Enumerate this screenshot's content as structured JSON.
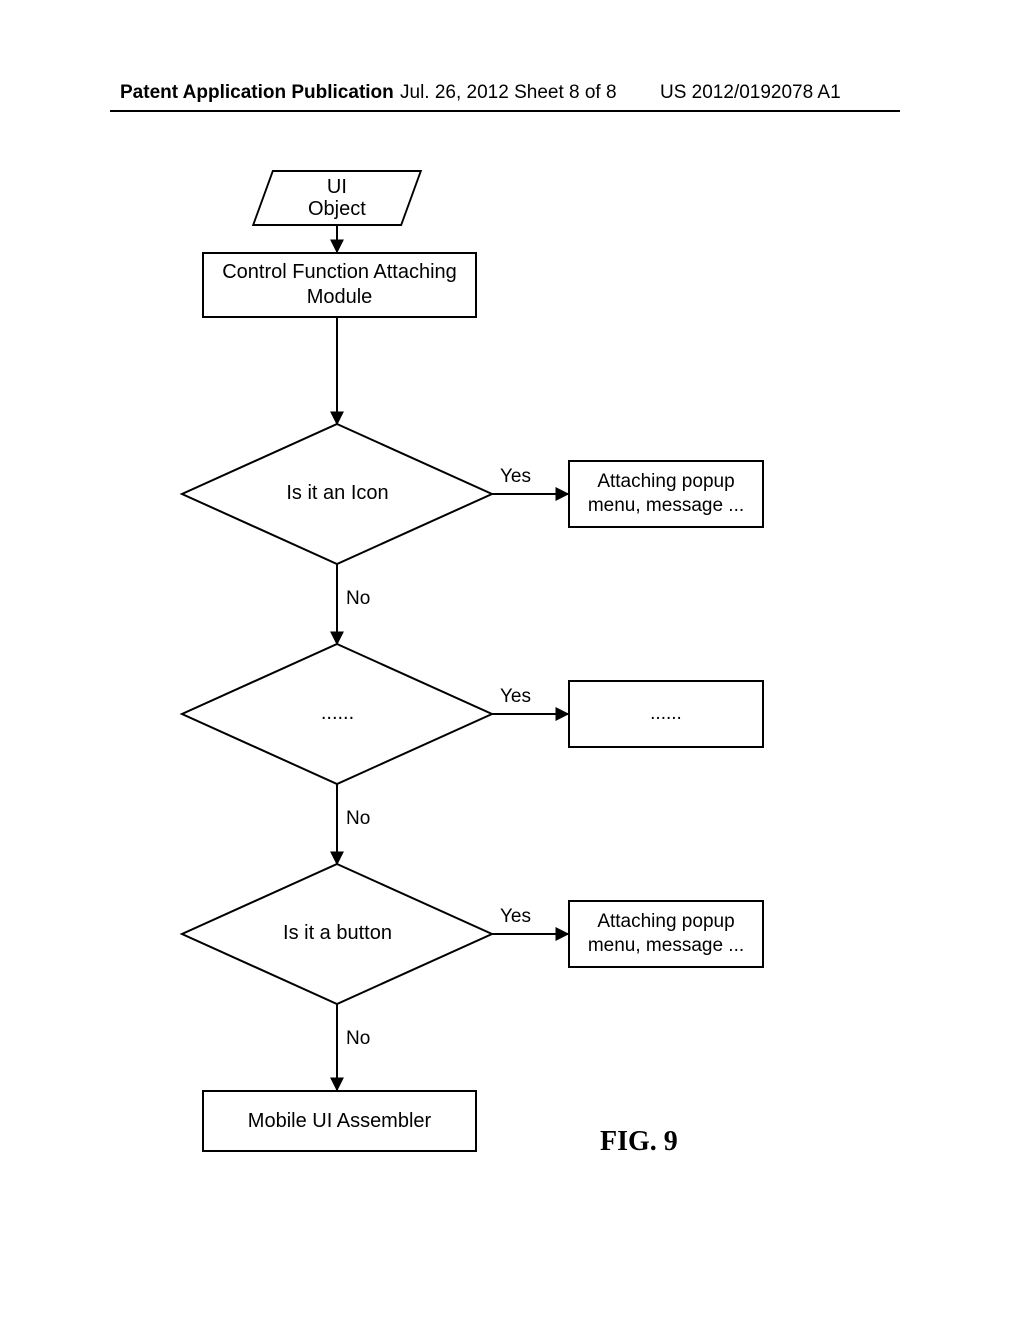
{
  "header": {
    "left": "Patent Application Publication",
    "mid": "Jul. 26, 2012  Sheet 8 of 8",
    "right": "US 2012/0192078 A1"
  },
  "figure": {
    "label": "FIG. 9",
    "start": "UI\nObject",
    "module": "Control Function Attaching\nModule",
    "decisions": [
      {
        "question": "Is it an Icon",
        "yes": "Yes",
        "no": "No",
        "action": "Attaching popup\nmenu, message ..."
      },
      {
        "question": "......",
        "yes": "Yes",
        "no": "No",
        "action": "......"
      },
      {
        "question": "Is it a button",
        "yes": "Yes",
        "no": "No",
        "action": "Attaching popup\nmenu, message ..."
      }
    ],
    "end": "Mobile UI Assembler"
  }
}
